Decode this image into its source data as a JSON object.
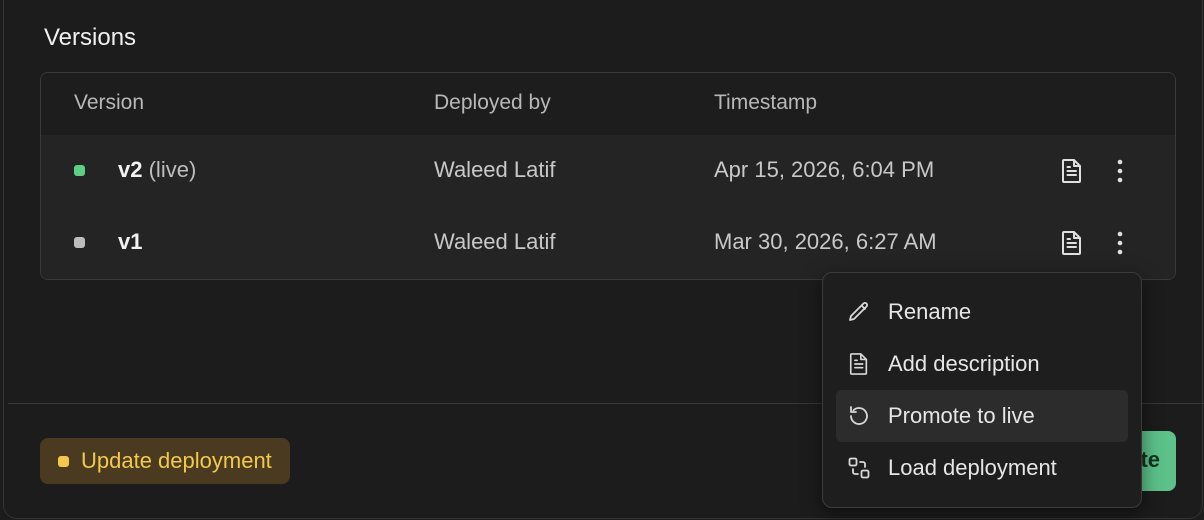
{
  "section": {
    "title": "Versions"
  },
  "table": {
    "headers": {
      "version": "Version",
      "deployed_by": "Deployed by",
      "timestamp": "Timestamp"
    },
    "rows": [
      {
        "version": "v2",
        "tag": "(live)",
        "deployed_by": "Waleed Latif",
        "timestamp": "Apr 15, 2026, 6:04 PM",
        "status_color": "#5bd183"
      },
      {
        "version": "v1",
        "tag": "",
        "deployed_by": "Waleed Latif",
        "timestamp": "Mar 30, 2026, 6:27 AM",
        "status_color": "#bdbdbd"
      }
    ]
  },
  "menu": {
    "items": [
      {
        "label": "Rename",
        "icon": "pencil-icon"
      },
      {
        "label": "Add description",
        "icon": "document-icon"
      },
      {
        "label": "Promote to live",
        "icon": "rotate-ccw-icon",
        "highlighted": true
      },
      {
        "label": "Load deployment",
        "icon": "load-icon"
      }
    ]
  },
  "footer": {
    "badge_label": "Update deployment",
    "badge_color": "#f2c94c",
    "primary_button_visible_text": "te",
    "primary_button_color": "#5cc28a"
  }
}
